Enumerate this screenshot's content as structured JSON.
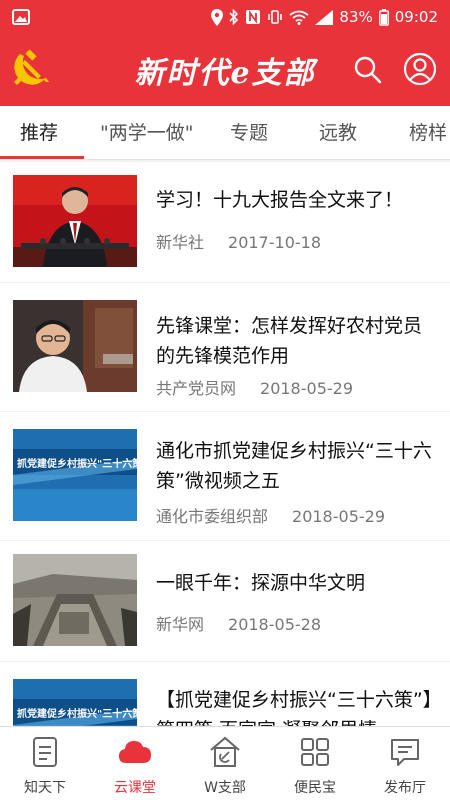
{
  "status_bar": {
    "battery": "83%",
    "time": "09:02"
  },
  "header": {
    "title": "新时代e支部"
  },
  "tabs": [
    {
      "label": "推荐"
    },
    {
      "label": "\"两学一做\""
    },
    {
      "label": "专题"
    },
    {
      "label": "远教"
    },
    {
      "label": "榜样"
    }
  ],
  "news": [
    {
      "title": "学习！十九大报告全文来了！",
      "source": "新华社",
      "date": "2017-10-18"
    },
    {
      "title": " 先锋课堂：怎样发挥好农村党员的先锋模范作用",
      "source": "共产党员网",
      "date": "2018-05-29"
    },
    {
      "title": "通化市抓党建促乡村振兴“三十六策”微视频之五",
      "source": "通化市委组织部",
      "date": "2018-05-29"
    },
    {
      "title": "一眼千年：探源中华文明",
      "source": "新华网",
      "date": "2018-05-28"
    },
    {
      "title": "【抓党建促乡村振兴“三十六策”】第四策 百家宣 凝聚邻里情",
      "source": "",
      "date": ""
    }
  ],
  "bottom_nav": [
    {
      "label": "知天下",
      "icon": "document-icon"
    },
    {
      "label": "云课堂",
      "icon": "cloud-icon"
    },
    {
      "label": "W支部",
      "icon": "party-house-icon"
    },
    {
      "label": "便民宝",
      "icon": "grid-icon"
    },
    {
      "label": "发布厅",
      "icon": "message-icon"
    }
  ],
  "colors": {
    "accent": "#e8333a",
    "emblem": "#f7c600"
  }
}
